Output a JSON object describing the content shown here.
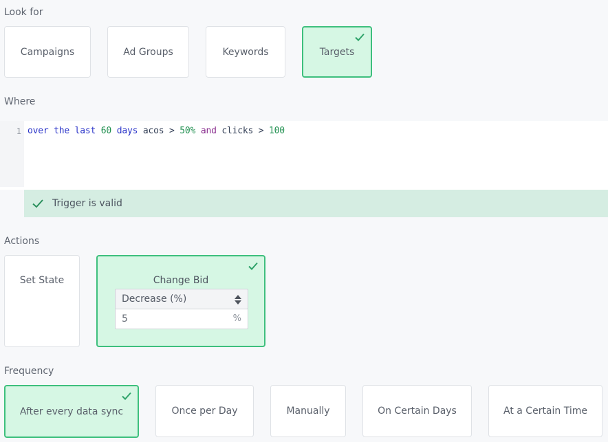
{
  "look_for": {
    "label": "Look for",
    "options": [
      {
        "label": "Campaigns",
        "selected": false
      },
      {
        "label": "Ad Groups",
        "selected": false
      },
      {
        "label": "Keywords",
        "selected": false
      },
      {
        "label": "Targets",
        "selected": true
      }
    ]
  },
  "where": {
    "label": "Where",
    "line_number": "1",
    "tokens": {
      "t1": "over the last",
      "t2": "60",
      "t3": "days",
      "t4": "acos",
      "t5": ">",
      "t6": "50%",
      "t7": "and",
      "t8": "clicks",
      "t9": ">",
      "t10": "100"
    },
    "status": "Trigger is valid"
  },
  "actions": {
    "label": "Actions",
    "set_state": "Set State",
    "change_bid": {
      "title": "Change Bid",
      "selected": true,
      "mode": "Decrease (%)",
      "value": "5",
      "unit": "%"
    }
  },
  "frequency": {
    "label": "Frequency",
    "options": [
      {
        "label": "After every data sync",
        "selected": true
      },
      {
        "label": "Once per Day",
        "selected": false
      },
      {
        "label": "Manually",
        "selected": false
      },
      {
        "label": "On Certain Days",
        "selected": false
      },
      {
        "label": "At a Certain Time",
        "selected": false
      }
    ]
  },
  "colors": {
    "accent": "#3ebf7d",
    "selected_bg": "#d6f7e4",
    "valid_bar": "#d5ede2"
  }
}
